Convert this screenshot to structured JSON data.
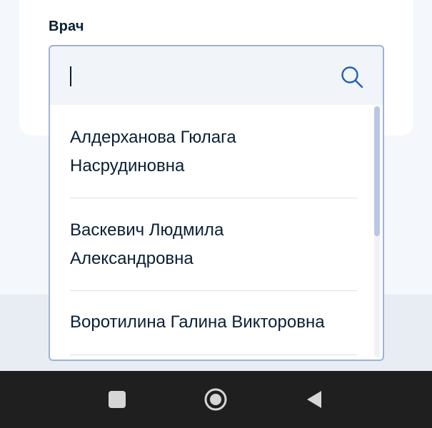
{
  "form": {
    "doctor_label": "Врач",
    "search_value": ""
  },
  "icons": {
    "search": "search-icon",
    "recents": "square-icon",
    "home": "circle-icon",
    "back": "triangle-back-icon"
  },
  "dropdown": {
    "options": [
      {
        "line1": "Алдерханова Гюлага",
        "line2": "Насрудиновна"
      },
      {
        "line1": "Васкевич Людмила",
        "line2": "Александровна"
      },
      {
        "line1": "Воротилина Галина Викторовна",
        "line2": ""
      }
    ]
  },
  "colors": {
    "accent": "#1f5fb4",
    "text": "#0b1f33",
    "border": "#9fb3d6",
    "nav_bar": "#1f1f1f"
  }
}
